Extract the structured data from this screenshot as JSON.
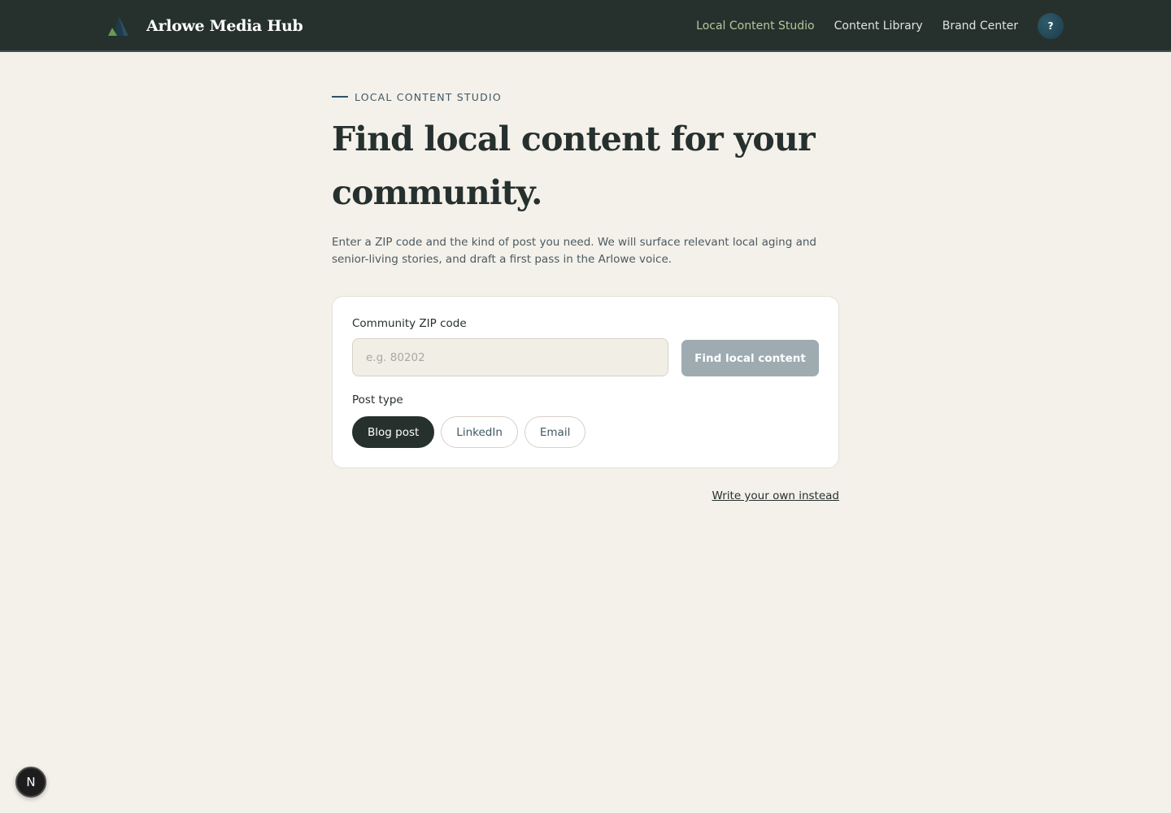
{
  "header": {
    "app_name": "Arlowe Media Hub",
    "logo_icon": "mountain-logo-icon",
    "nav": [
      {
        "label": "Local Content Studio",
        "active": true
      },
      {
        "label": "Content Library",
        "active": false
      },
      {
        "label": "Brand Center",
        "active": false
      }
    ],
    "help_label": "?"
  },
  "main": {
    "eyebrow": "LOCAL CONTENT STUDIO",
    "headline": "Find local content for your community.",
    "lede": "Enter a ZIP code and the kind of post you need. We will surface relevant local aging and senior-living stories, and draft a first pass in the Arlowe voice.",
    "form": {
      "zip_label": "Community ZIP code",
      "zip_value": "",
      "zip_placeholder": "e.g. 80202",
      "find_button": "Find local content",
      "post_type_label": "Post type",
      "post_types": [
        {
          "label": "Blog post",
          "selected": true
        },
        {
          "label": "LinkedIn",
          "selected": false
        },
        {
          "label": "Email",
          "selected": false
        }
      ]
    },
    "write_own_link": "Write your own instead"
  },
  "floating_badge": "N",
  "colors": {
    "header_bg": "#26312e",
    "page_bg": "#f4f1ea",
    "active_nav": "#b3c79b",
    "primary_dark": "#26312e",
    "button_disabled": "#9eacb2",
    "accent_blue": "#2b5468"
  }
}
